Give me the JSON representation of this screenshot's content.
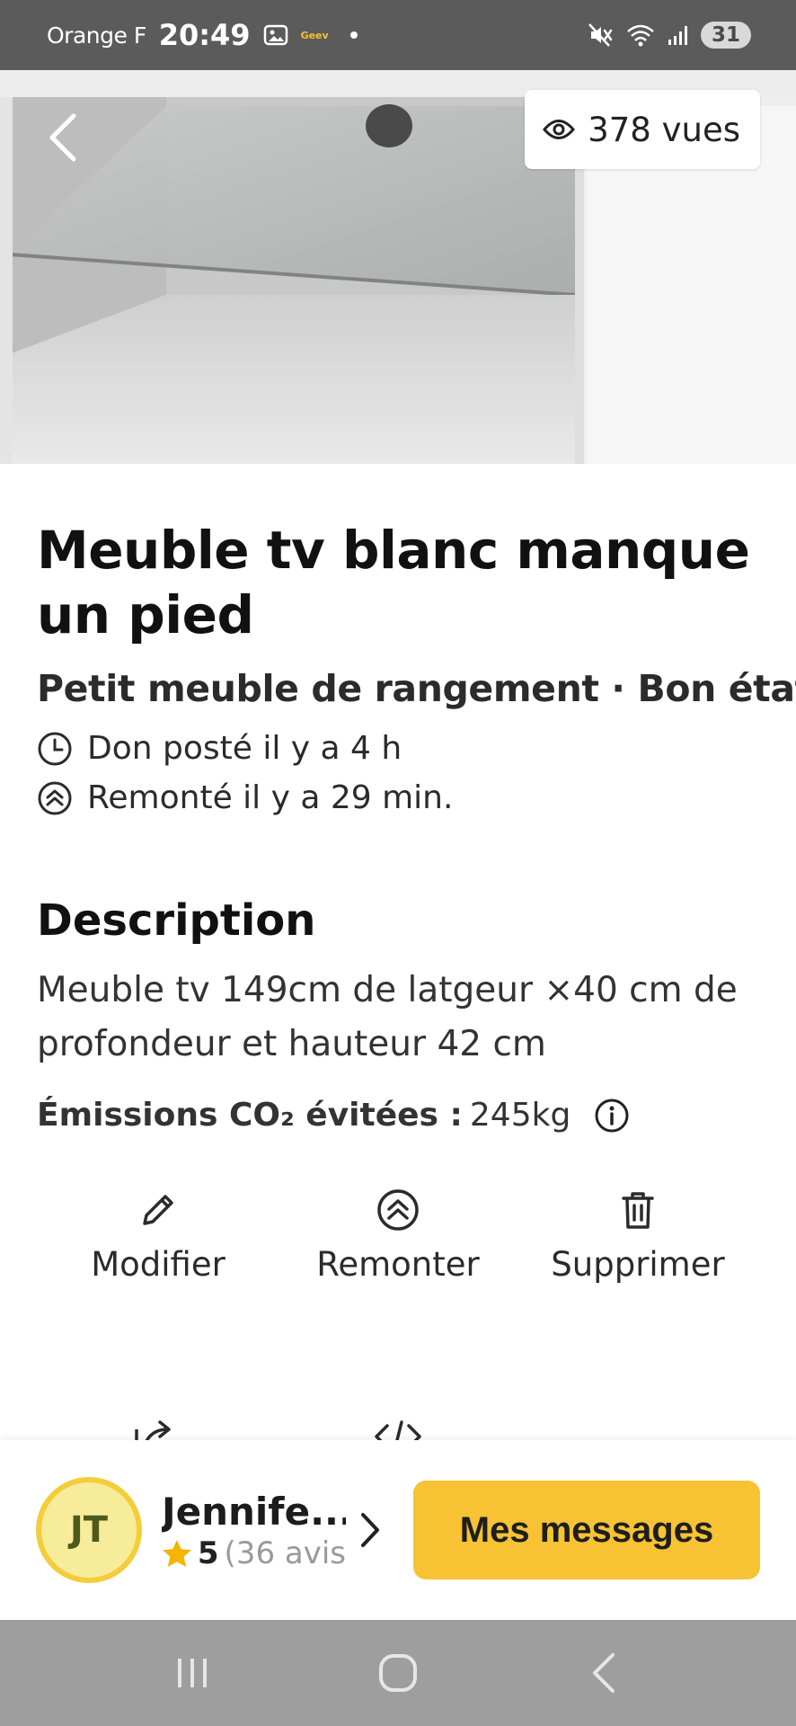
{
  "status_bar": {
    "carrier": "Orange F",
    "time": "20:49",
    "app_mini": "Geev",
    "battery": "31"
  },
  "hero": {
    "views": "378 vues"
  },
  "listing": {
    "title": "Meuble tv blanc manque un pied",
    "subtitle": "Petit meuble de rangement · Bon état",
    "posted": "Don posté il y a 4 h",
    "bumped": "Remonté il y a 29 min.",
    "description_heading": "Description",
    "description": "Meuble tv 149cm de latgeur ×40 cm de profondeur et hauteur 42 cm",
    "co2_label": "Émissions CO₂ évitées :",
    "co2_value": "245kg"
  },
  "actions": {
    "edit": "Modifier",
    "bump": "Remonter",
    "delete": "Supprimer"
  },
  "seller": {
    "initials": "JT",
    "name": "Jennife...",
    "rating": "5",
    "reviews": "(36 avis"
  },
  "cta": {
    "messages": "Mes messages"
  },
  "colors": {
    "accent": "#f7c234",
    "avatar_ring": "#f4cd3a",
    "star": "#f4b400"
  }
}
